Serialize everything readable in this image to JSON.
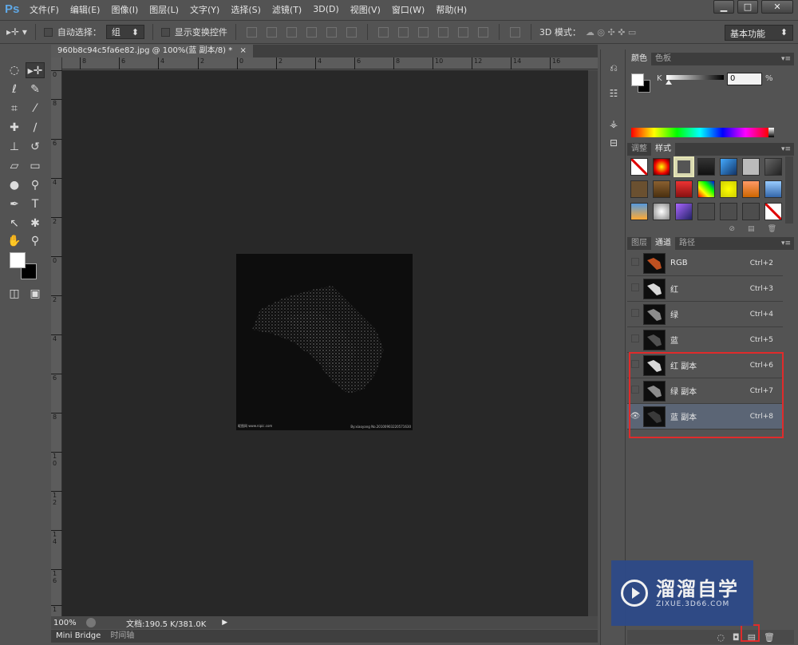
{
  "app": {
    "logo": "Ps"
  },
  "menu": [
    "文件(F)",
    "编辑(E)",
    "图像(I)",
    "图层(L)",
    "文字(Y)",
    "选择(S)",
    "滤镜(T)",
    "3D(D)",
    "视图(V)",
    "窗口(W)",
    "帮助(H)"
  ],
  "window_buttons": {
    "minimize": "▁",
    "restore": "□",
    "close": "✕"
  },
  "options": {
    "auto_select_label": "自动选择：",
    "auto_select_value": "组",
    "show_transform_label": "显示变换控件",
    "mode_3d_label": "3D 模式：",
    "workspace": "基本功能"
  },
  "document": {
    "tab_title": "960b8c94c5fa6e82.jpg @ 100%(蓝 副本/8) *",
    "tab_close": "×",
    "ruler_h_ticks": [
      "8",
      "6",
      "4",
      "2",
      "0",
      "2",
      "4",
      "6",
      "8",
      "10",
      "12",
      "14",
      "16"
    ],
    "ruler_v_ticks": [
      "0",
      "8",
      "6",
      "4",
      "2",
      "0",
      "2",
      "4",
      "6",
      "8",
      "1 0",
      "1 2",
      "1 4",
      "1 6",
      "1"
    ],
    "image_caption_left": "昵图网 www.nipic.com",
    "image_caption_right": "By:xiaoyang No.20100903220571630"
  },
  "status": {
    "zoom": "100%",
    "doc_info": "文档:190.5 K/381.0K"
  },
  "bottom_tabs": [
    "Mini Bridge",
    "时间轴"
  ],
  "color_panel": {
    "tabs": [
      "颜色",
      "色板"
    ],
    "channel_label": "K",
    "value": "0",
    "unit": "%"
  },
  "styles_panel": {
    "tabs": [
      "调整",
      "样式"
    ]
  },
  "channels_panel": {
    "tabs": [
      "图层",
      "通道",
      "路径"
    ],
    "channels": [
      {
        "name": "RGB",
        "shortcut": "Ctrl+2"
      },
      {
        "name": "红",
        "shortcut": "Ctrl+3"
      },
      {
        "name": "绿",
        "shortcut": "Ctrl+4"
      },
      {
        "name": "蓝",
        "shortcut": "Ctrl+5"
      },
      {
        "name": "红 副本",
        "shortcut": "Ctrl+6"
      },
      {
        "name": "绿 副本",
        "shortcut": "Ctrl+7"
      },
      {
        "name": "蓝 副本",
        "shortcut": "Ctrl+8"
      }
    ]
  },
  "watermark": {
    "title": "溜溜自学",
    "subtitle": "ZIXUE.3D66.COM"
  },
  "colors": {
    "selected_channel": "#5b6575",
    "highlight": "#e02b2b",
    "watermark_bg": "#2d4a8a"
  }
}
